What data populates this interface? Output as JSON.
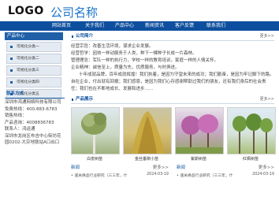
{
  "header": {
    "logo": "LOGO",
    "company": "公司名称"
  },
  "nav": {
    "items": [
      "网站首页",
      "关于我们",
      "产品中心",
      "新闻资讯",
      "客户反馈",
      "联系我们"
    ]
  },
  "left": {
    "products_title": "产品中心",
    "products": [
      {
        "label": "可视化分类一"
      },
      {
        "label": "可视化分类二"
      },
      {
        "label": "可视化分类三"
      },
      {
        "label": "可视化分类四"
      },
      {
        "label": "可视化分类五"
      }
    ],
    "contact_title": "联系方式",
    "contact_lines": [
      "深圳市鸿通网络科技有限公司",
      "免费热线：400-883-6783",
      "销售热线：",
      "产品咨询：4008836783",
      "联系人：鸿运通",
      "深圳市龙岗区布吉中心街坊花园0202-大芬地铁站A口出口"
    ]
  },
  "main": {
    "about_title": "公司简介",
    "about_more": "更多>>",
    "about_lines": [
      "经营宗旨：改善生活环境，谋求企业发展。",
      "经营哲学：因效一样动服务于人类，种下一棵种子长成一片森林。",
      "管理理念：军队一样的执行力，学校一样的教育培训，家庭一样的人情关怀。",
      "企业精神：诚信至上，质量为先，优质服务，与时俱进。",
      "十年成就品牌，百年成就辉煌！我们执着，是因为守望未来的成功；我们勤奋，是因为牢记脚下的路。",
      "自在企业，付出就有回报；我们感恩，是因为我们心存感谢帮助过我们的朋友，还有我们身后的社会责任；我们也在不断地成长、发展和进步……"
    ],
    "products_title": "产品展示",
    "products_more": "更多>>",
    "images": [
      {
        "caption": "白皮树苗"
      },
      {
        "caption": "金丝垂柳小苗"
      },
      {
        "caption": "紫斯树苗"
      },
      {
        "caption": "红枫树苗"
      }
    ],
    "news": {
      "title_left": "新闻",
      "more_left": "更多>>",
      "title_right": "新闻",
      "more_right": "更多>>",
      "left_items": [
        {
          "title": "• 速关换品行业研究（三三年，什",
          "date": "2024-03-19"
        }
      ],
      "right_items": [
        {
          "title": "• 速关换品行业研究（三三年，什",
          "date": "2024-03-19"
        }
      ]
    }
  }
}
